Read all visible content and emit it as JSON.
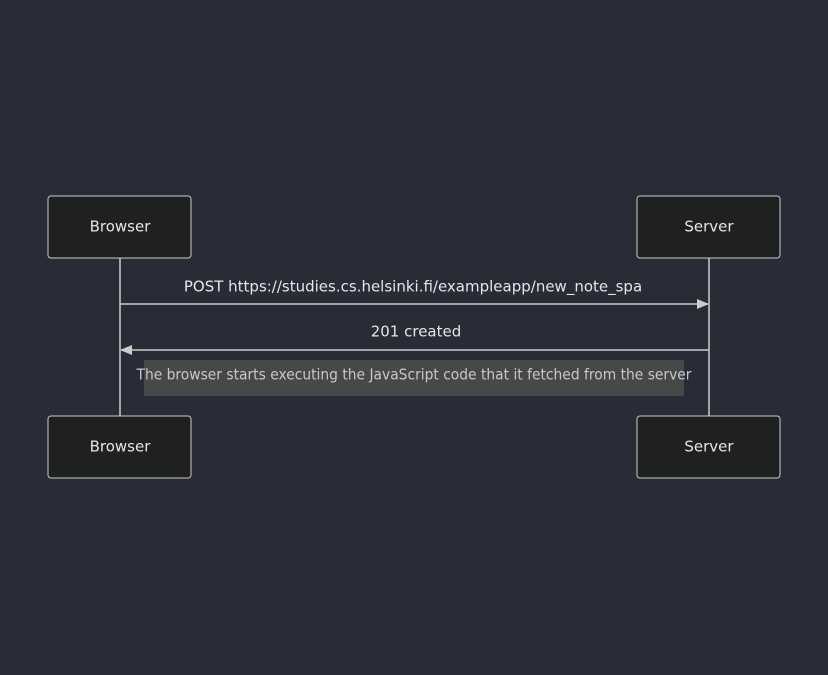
{
  "diagram": {
    "participants": [
      {
        "id": "browser",
        "label": "Browser"
      },
      {
        "id": "server",
        "label": "Server"
      }
    ],
    "messages": [
      {
        "from": "browser",
        "to": "server",
        "label": "POST https://studies.cs.helsinki.fi/exampleapp/new_note_spa",
        "style": "solid"
      },
      {
        "from": "server",
        "to": "browser",
        "label": "201 created",
        "style": "solid"
      }
    ],
    "notes": [
      {
        "over": [
          "browser",
          "server"
        ],
        "text": "The browser starts executing the JavaScript code that it fetched from the server"
      }
    ]
  },
  "colors": {
    "background": "#282c37",
    "actor_fill": "#1f2020",
    "line": "#cccccc",
    "note_fill": "#474949",
    "text": "#e6e6e6"
  }
}
